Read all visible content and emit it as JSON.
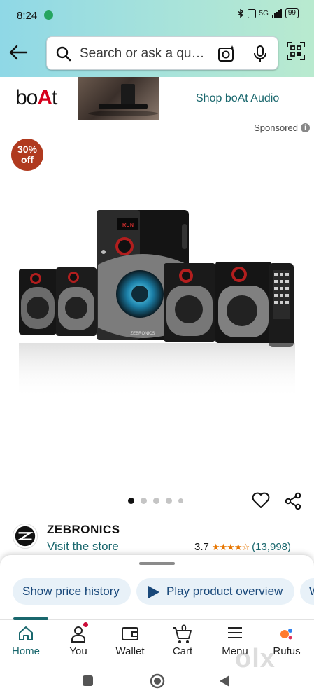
{
  "status_bar": {
    "time": "8:24",
    "network": "5G",
    "battery": "99"
  },
  "search": {
    "placeholder": "Search or ask a qu…"
  },
  "sponsored_banner": {
    "brand_logo_text": "boAt",
    "link_label": "Shop boAt Audio",
    "sponsored_label": "Sponsored"
  },
  "product": {
    "discount_badge": {
      "line1": "30%",
      "line2": "off"
    },
    "image_dots_count": 5,
    "active_dot": 0,
    "brand_name": "ZEBRONICS",
    "visit_store_label": "Visit the store",
    "rating_value": "3.7",
    "rating_stars": 3.7,
    "rating_count": "(13,998)",
    "speaker_display_text": "RUN",
    "speaker_logo_text": "ZEBRONICS"
  },
  "bottom_sheet": {
    "chips": [
      {
        "label": "Show price history"
      },
      {
        "label": "Play product overview"
      },
      {
        "label": "W"
      }
    ]
  },
  "bottom_nav": {
    "items": [
      {
        "label": "Home",
        "icon": "home-icon",
        "active": true
      },
      {
        "label": "You",
        "icon": "person-icon",
        "badge_dot": true
      },
      {
        "label": "Wallet",
        "icon": "wallet-icon"
      },
      {
        "label": "Cart",
        "icon": "cart-icon",
        "count": "0"
      },
      {
        "label": "Menu",
        "icon": "hamburger-menu-icon"
      },
      {
        "label": "Rufus",
        "icon": "rufus-icon"
      }
    ]
  },
  "watermark": {
    "text": "olx"
  },
  "colors": {
    "header_gradient_start": "#8fd8e6",
    "header_gradient_end": "#b9eacf",
    "link_teal": "#19676d",
    "badge_red": "#b03a1f",
    "star_orange": "#e77600",
    "chip_bg": "#e8f1f8"
  }
}
